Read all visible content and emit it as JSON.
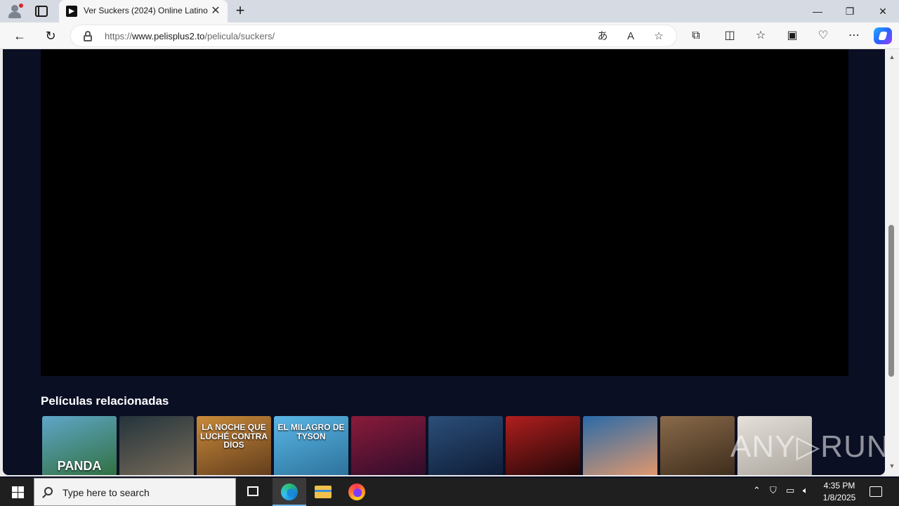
{
  "browser": {
    "tab_title": "Ver Suckers (2024) Online Latino",
    "close_tab": "✕",
    "new_tab": "+",
    "url_scheme": "https://",
    "url_host": "www.pelisplus2.to",
    "url_path": "/pelicula/suckers/",
    "window_controls": {
      "minimize": "—",
      "restore": "❐",
      "close": "✕"
    },
    "toolbar_icons": [
      "extensions-icon",
      "split-screen-icon",
      "favorites-icon",
      "collections-icon",
      "browser-essentials-icon",
      "more-icon",
      "copilot-icon"
    ]
  },
  "page": {
    "related_title": "Películas relacionadas",
    "posters": [
      {
        "caption": "PANDA",
        "colors": [
          "#5fa6c9",
          "#2f6e3a"
        ]
      },
      {
        "caption": "",
        "colors": [
          "#24343c",
          "#7b6d5a"
        ]
      },
      {
        "caption": "LA NOCHE QUE LUCHÉ CONTRA DIOS",
        "colors": [
          "#c98a3a",
          "#5e3a1b"
        ]
      },
      {
        "caption": "EL MILAGRO DE TYSON",
        "colors": [
          "#5ab6e6",
          "#2b6f98"
        ]
      },
      {
        "caption": "",
        "colors": [
          "#8a1b3a",
          "#2a0b2a"
        ]
      },
      {
        "caption": "",
        "colors": [
          "#2b4f7a",
          "#0d1a33"
        ]
      },
      {
        "caption": "",
        "colors": [
          "#b01e1e",
          "#1a0606"
        ]
      },
      {
        "caption": "",
        "colors": [
          "#2a6aa8",
          "#e89a6a"
        ]
      },
      {
        "caption": "",
        "colors": [
          "#8a6a4a",
          "#3a2a1a"
        ]
      },
      {
        "caption": "",
        "colors": [
          "#e4e0da",
          "#a8a29a"
        ]
      }
    ],
    "watermark": "ANY▷RUN"
  },
  "taskbar": {
    "search_placeholder": "Type here to search",
    "time": "4:35 PM",
    "date": "1/8/2025"
  }
}
